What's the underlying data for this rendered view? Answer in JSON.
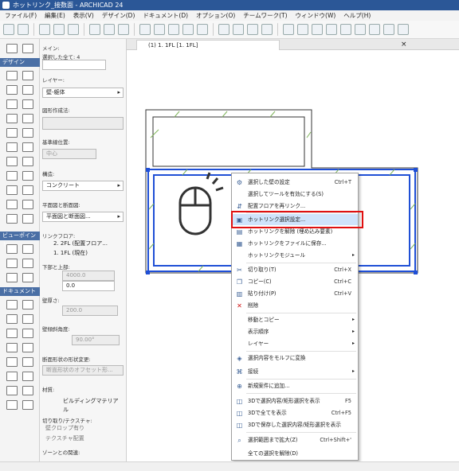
{
  "window": {
    "title": "ホットリンク_接数面 - ARCHICAD 24"
  },
  "menubar": [
    "ファイル(F)",
    "編集(E)",
    "表示(V)",
    "デザイン(D)",
    "ドキュメント(D)",
    "オプション(O)",
    "チームワーク(T)",
    "ウィンドウ(W)",
    "ヘルプ(H)"
  ],
  "toolbox": {
    "headers": [
      "デザイン",
      "ビューポイント",
      "ドキュメント"
    ]
  },
  "infobox": {
    "main_label": "メイン:",
    "selection_count": "選択した全て: 4",
    "layer_label": "レイヤー:",
    "layer_value": "壁-躯体",
    "geometry_label": "図形作成法:",
    "ref_label": "基準線位置:",
    "ref_value": "中心",
    "structure_label": "構造:",
    "structure_value": "コンクリート",
    "floorplan_label": "平面図と断面図:",
    "floorplan_value": "平面図と断面図...",
    "link_floor_label": "リンクフロア:",
    "link_floor_1": "2. 2FL (配置フロア...",
    "link_floor_2": "1. 1FL (現在)",
    "top_offset_label": "下部と上部:",
    "height_value": "4000.0",
    "offset_value": "0.0",
    "thickness_label": "壁厚さ:",
    "thickness_value": "200.0",
    "angle_label": "壁傾斜角度:",
    "angle_value": "90.00°",
    "profile_label": "断面形状の形状変更:",
    "profile_value": "断面形状のオフセット形...",
    "material_label": "材質:",
    "material_value": "ビルディングマテリアル",
    "trim_label": "切り取り/テクスチャ:",
    "trim_item": "壁クロップ有り",
    "texture_item": "テクスチャ配置",
    "zone_label": "ゾーンとの関連:"
  },
  "tabs": [
    {
      "label": "(1) 1. 1FL [1. 1FL]"
    }
  ],
  "context_menu": {
    "items": [
      {
        "label": "選択した壁の設定",
        "shortcut": "Ctrl+T",
        "icon": "wall-settings-icon"
      },
      {
        "label": "選択してツールを有効にする(S)",
        "shortcut": "",
        "icon": ""
      },
      {
        "label": "配置フロアを再リンク...",
        "shortcut": "",
        "icon": "relink-icon"
      },
      {
        "label": "ホットリンク選択設定...",
        "shortcut": "",
        "icon": "hotlink-settings-icon",
        "highlighted": true
      },
      {
        "label": "ホットリンクを解除 (埋め込み要素)",
        "shortcut": "",
        "icon": "hotlink-break-icon"
      },
      {
        "label": "ホットリンクをファイルに保存...",
        "shortcut": "",
        "icon": "save-icon"
      },
      {
        "label": "ホットリンクモジュール",
        "shortcut": "",
        "icon": "",
        "submenu": true
      },
      {
        "label": "切り取り(T)",
        "shortcut": "Ctrl+X",
        "icon": "scissors-icon"
      },
      {
        "label": "コピー(C)",
        "shortcut": "Ctrl+C",
        "icon": "copy-icon"
      },
      {
        "label": "貼り付け(P)",
        "shortcut": "Ctrl+V",
        "icon": "paste-icon"
      },
      {
        "label": "削除",
        "shortcut": "",
        "icon": "delete-icon"
      },
      {
        "label": "移動とコピー",
        "shortcut": "",
        "icon": "",
        "submenu": true
      },
      {
        "label": "表示順序",
        "shortcut": "",
        "icon": "",
        "submenu": true
      },
      {
        "label": "レイヤー",
        "shortcut": "",
        "icon": "",
        "submenu": true
      },
      {
        "label": "選択内容をモルフに変換",
        "shortcut": "",
        "icon": "morph-icon"
      },
      {
        "label": "接続",
        "shortcut": "",
        "icon": "connect-icon",
        "submenu": true
      },
      {
        "label": "新規案件に追加...",
        "shortcut": "",
        "icon": "add-icon"
      },
      {
        "label": "3Dで選択内容/矩形選択を表示",
        "shortcut": "F5",
        "icon": "3d-icon"
      },
      {
        "label": "3Dで全てを表示",
        "shortcut": "Ctrl+F5",
        "icon": "3d-all-icon"
      },
      {
        "label": "3Dで保存した選択内容/矩形選択を表示",
        "shortcut": "",
        "icon": "3d-saved-icon"
      },
      {
        "label": "選択範囲まで拡大(Z)",
        "shortcut": "Ctrl+Shift+'",
        "icon": "zoom-icon"
      },
      {
        "label": "全ての選択を解除(D)",
        "shortcut": "",
        "icon": ""
      }
    ]
  },
  "colors": {
    "accent_blue": "#1f4fd6",
    "wall_green": "#7fb35a",
    "highlight": "#e01010"
  }
}
